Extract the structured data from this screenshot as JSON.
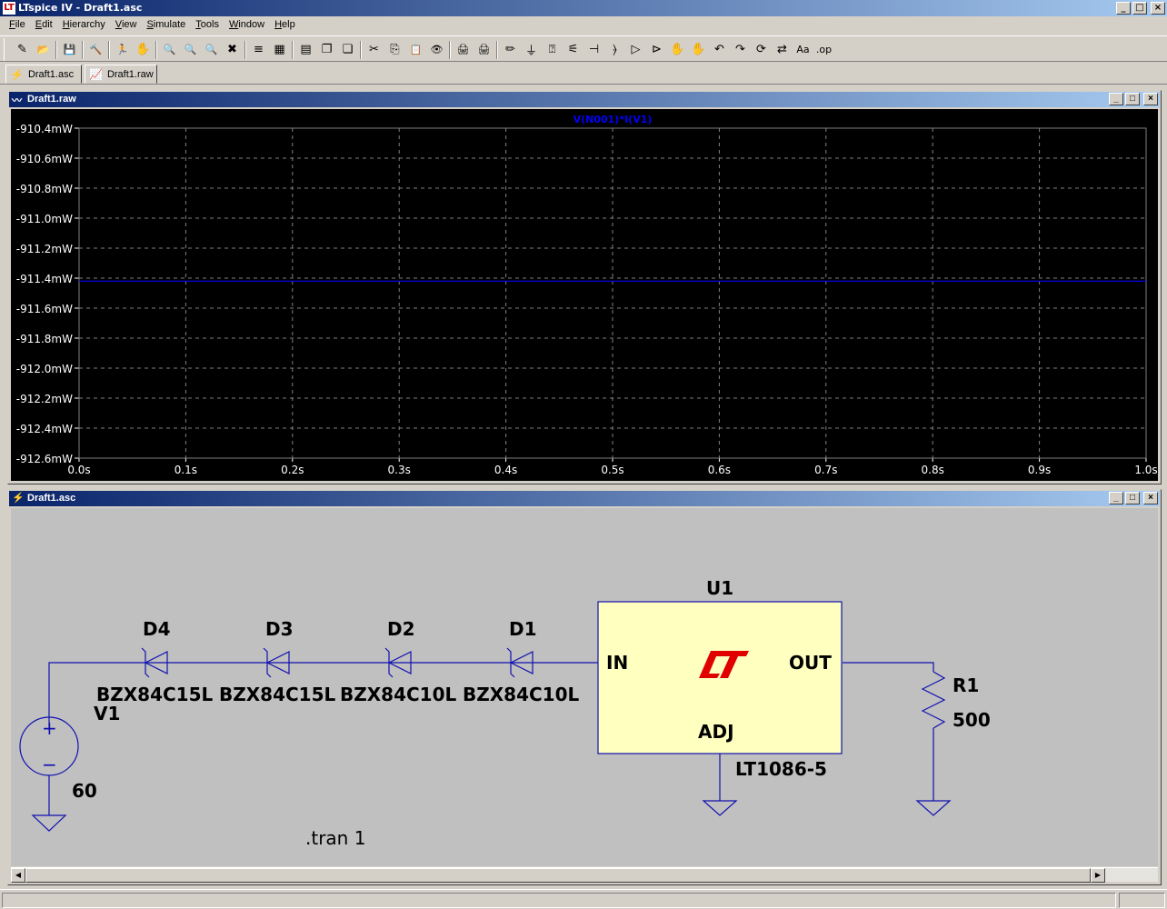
{
  "app": {
    "title": "LTspice IV - Draft1.asc",
    "logo": "LT"
  },
  "window_controls": {
    "minimize": "_",
    "restore": "□",
    "close": "×"
  },
  "menu": [
    {
      "label": "File",
      "u": "F",
      "rest": "ile"
    },
    {
      "label": "Edit",
      "u": "E",
      "rest": "dit"
    },
    {
      "label": "Hierarchy",
      "u": "H",
      "rest": "ierarchy"
    },
    {
      "label": "View",
      "u": "V",
      "rest": "iew"
    },
    {
      "label": "Simulate",
      "u": "S",
      "rest": "imulate"
    },
    {
      "label": "Tools",
      "u": "T",
      "rest": "ools"
    },
    {
      "label": "Window",
      "u": "W",
      "rest": "indow"
    },
    {
      "label": "Help",
      "u": "H",
      "rest": "elp"
    }
  ],
  "toolbar": [
    {
      "name": "new-schematic-icon",
      "glyph": "✎"
    },
    {
      "name": "open-icon",
      "glyph": "📂"
    },
    {
      "sep": true
    },
    {
      "name": "save-icon",
      "glyph": "💾"
    },
    {
      "sep": true
    },
    {
      "name": "control-panel-icon",
      "glyph": "🔨"
    },
    {
      "sep": true
    },
    {
      "name": "run-icon",
      "glyph": "🏃"
    },
    {
      "name": "halt-icon",
      "glyph": "✋"
    },
    {
      "sep": true
    },
    {
      "name": "zoom-in-icon",
      "glyph": "🔍"
    },
    {
      "name": "pan-icon",
      "glyph": "🔍"
    },
    {
      "name": "zoom-out-icon",
      "glyph": "🔍"
    },
    {
      "name": "zoom-fit-icon",
      "glyph": "✖"
    },
    {
      "sep": true
    },
    {
      "name": "autorange-icon",
      "glyph": "≡"
    },
    {
      "name": "grid-icon",
      "glyph": "▦"
    },
    {
      "sep": true
    },
    {
      "name": "tile-horizontal-icon",
      "glyph": "▤"
    },
    {
      "name": "cascade-icon",
      "glyph": "❐"
    },
    {
      "name": "tile-vertical-icon",
      "glyph": "❏"
    },
    {
      "sep": true
    },
    {
      "name": "cut-icon",
      "glyph": "✂"
    },
    {
      "name": "copy-icon",
      "glyph": "⎘"
    },
    {
      "name": "paste-icon",
      "glyph": "📋"
    },
    {
      "name": "find-icon",
      "glyph": "👁"
    },
    {
      "sep": true
    },
    {
      "name": "print-setup-icon",
      "glyph": "🖨"
    },
    {
      "name": "print-icon",
      "glyph": "🖨"
    },
    {
      "sep": true
    },
    {
      "name": "wire-icon",
      "glyph": "✏"
    },
    {
      "name": "ground-icon",
      "glyph": "⏚"
    },
    {
      "name": "label-net-icon",
      "glyph": "⍰"
    },
    {
      "name": "resistor-icon",
      "glyph": "⚟"
    },
    {
      "name": "capacitor-icon",
      "glyph": "⊣"
    },
    {
      "name": "inductor-icon",
      "glyph": "⦒"
    },
    {
      "name": "diode-icon",
      "glyph": "▷"
    },
    {
      "name": "component-icon",
      "glyph": "⊳"
    },
    {
      "name": "move-icon",
      "glyph": "✋"
    },
    {
      "name": "drag-icon",
      "glyph": "✋"
    },
    {
      "name": "undo-icon",
      "glyph": "↶"
    },
    {
      "name": "redo-icon",
      "glyph": "↷"
    },
    {
      "name": "rotate-icon",
      "glyph": "⟳"
    },
    {
      "name": "mirror-icon",
      "glyph": "⇄"
    },
    {
      "name": "text-icon",
      "glyph": "Aa"
    },
    {
      "name": "spice-directive-icon",
      "glyph": ".op"
    }
  ],
  "tabs": [
    {
      "label": "Draft1.asc",
      "icon": "schematic-tab-icon",
      "glyph": "⚡"
    },
    {
      "label": "Draft1.raw",
      "icon": "waveform-tab-icon",
      "glyph": "📈"
    }
  ],
  "waveform_window": {
    "title": "Draft1.raw",
    "trace_label": "V(N001)*I(V1)"
  },
  "schematic_window": {
    "title": "Draft1.asc"
  },
  "schematic": {
    "components": {
      "d4_ref": "D4",
      "d4_value": "BZX84C15L",
      "d3_ref": "D3",
      "d3_value": "BZX84C15L",
      "d2_ref": "D2",
      "d2_value": "BZX84C10L",
      "d1_ref": "D1",
      "d1_value": "BZX84C10L",
      "u1_ref": "U1",
      "u1_value": "LT1086-5",
      "u1_in": "IN",
      "u1_out": "OUT",
      "u1_adj": "ADJ",
      "v1_ref": "V1",
      "v1_value": "60",
      "v1_plus": "+",
      "v1_minus": "−",
      "r1_ref": "R1",
      "r1_value": "500"
    },
    "directive": ".tran 1"
  },
  "chart_data": {
    "type": "line",
    "title": "V(N001)*I(V1)",
    "xlabel": "",
    "ylabel": "",
    "x_ticks": [
      "0.0s",
      "0.1s",
      "0.2s",
      "0.3s",
      "0.4s",
      "0.5s",
      "0.6s",
      "0.7s",
      "0.8s",
      "0.9s",
      "1.0s"
    ],
    "y_ticks": [
      "-910.4mW",
      "-910.6mW",
      "-910.8mW",
      "-911.0mW",
      "-911.2mW",
      "-911.4mW",
      "-911.6mW",
      "-911.8mW",
      "-912.0mW",
      "-912.2mW",
      "-912.4mW",
      "-912.6mW"
    ],
    "xlim": [
      0,
      1.0
    ],
    "ylim": [
      -912.6,
      -910.4
    ],
    "grid": true,
    "series": [
      {
        "name": "V(N001)*I(V1)",
        "x": [
          0,
          1.0
        ],
        "y": [
          -911.42,
          -911.42
        ],
        "color": "#0000ff"
      }
    ],
    "colors": {
      "background": "#000000",
      "grid": "#808080",
      "axis_text": "#ffffff",
      "trace": "#0000ff"
    }
  }
}
